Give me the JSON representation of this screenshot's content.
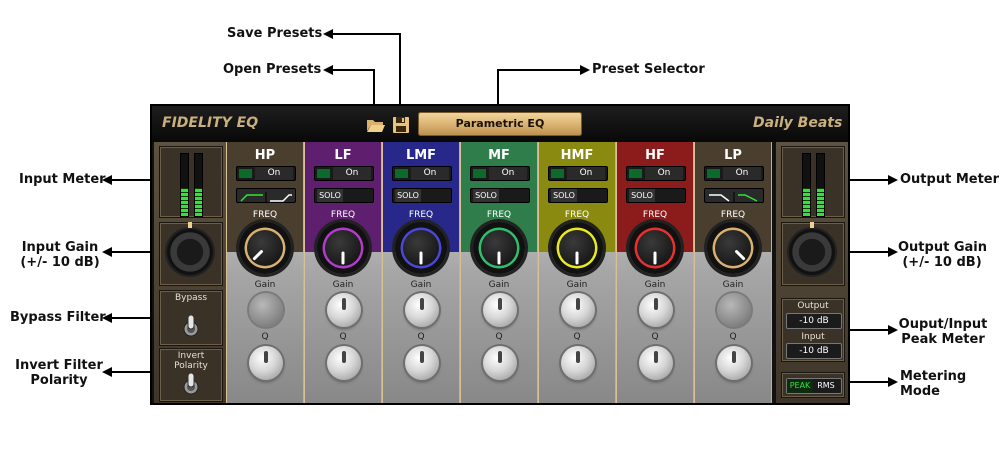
{
  "callouts": {
    "save_presets": "Save Presets",
    "open_presets": "Open Presets",
    "preset_selector": "Preset Selector",
    "input_meter": "Input Meter",
    "input_gain_1": "Input Gain",
    "input_gain_2": "(+/- 10 dB)",
    "bypass_filter": "Bypass Filter",
    "invert_polarity_1": "Invert Filter",
    "invert_polarity_2": "Polarity",
    "output_meter": "Output Meter",
    "output_gain_1": "Output Gain",
    "output_gain_2": "(+/- 10 dB)",
    "peak_meter_1": "Ouput/Input",
    "peak_meter_2": "Peak Meter",
    "metering_1": "Metering",
    "metering_2": "Mode"
  },
  "plugin": {
    "title": "FIDELITY EQ",
    "brand": "Daily Beats",
    "preset": "Parametric EQ",
    "icons": {
      "open": "folder-open-icon",
      "save": "floppy-disk-icon"
    }
  },
  "left_panel": {
    "bypass_label": "Bypass",
    "invert_label": "Invert Polarity",
    "input_meter_levels": [
      0.45,
      0.45
    ]
  },
  "right_panel": {
    "output_label": "Output",
    "output_value": "-10 dB",
    "input_label": "Input",
    "input_value": "-10 dB",
    "peak_label": "PEAK",
    "rms_label": "RMS",
    "output_meter_levels": [
      0.45,
      0.45
    ]
  },
  "labels": {
    "freq": "FREQ",
    "gain": "Gain",
    "q": "Q",
    "on": "On",
    "solo": "SOLO"
  },
  "bands": [
    {
      "name": "HP",
      "color": "#4a3f2e",
      "knob_color": "#d8b070",
      "has_solo": false
    },
    {
      "name": "LF",
      "color": "#5e1f6e",
      "knob_color": "#b43acb",
      "has_solo": true
    },
    {
      "name": "LMF",
      "color": "#28278a",
      "knob_color": "#4a47d8",
      "has_solo": true
    },
    {
      "name": "MF",
      "color": "#2e7d4a",
      "knob_color": "#2fbf6a",
      "has_solo": true
    },
    {
      "name": "HMF",
      "color": "#8a8a10",
      "knob_color": "#e8e820",
      "has_solo": true
    },
    {
      "name": "HF",
      "color": "#8c1b1b",
      "knob_color": "#e83030",
      "has_solo": true
    },
    {
      "name": "LP",
      "color": "#4a3f2e",
      "knob_color": "#d8b070",
      "has_solo": false
    }
  ]
}
